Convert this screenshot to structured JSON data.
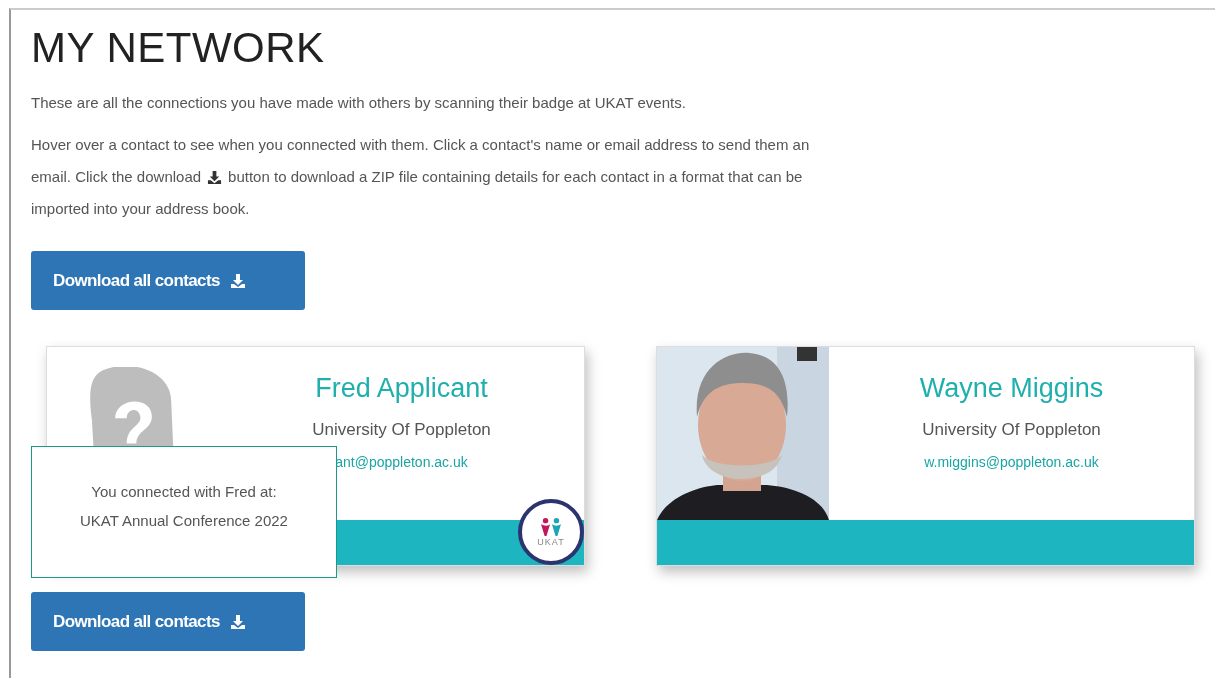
{
  "title": "MY NETWORK",
  "intro": "These are all the connections you have made with others by scanning their badge at UKAT events.",
  "instructions": {
    "line_1": "Hover over a contact to see when you connected with them. Click a contact's name or email address to send them an",
    "before_icon": "email. Click the download",
    "after_icon": "button to download a ZIP file containing details for each contact in a format that can be",
    "line_3": "imported into your address book."
  },
  "download_button_top": "Download all contacts",
  "contacts": [
    {
      "kind": "placeholder",
      "name": "Fred Applicant",
      "organisation": "University Of Poppleton",
      "email": "ant@poppleton.ac.uk",
      "badge": "UKAT"
    },
    {
      "kind": "picture",
      "name": "Wayne Miggins",
      "organisation": "University Of Poppleton",
      "email": "w.miggins@poppleton.ac.uk"
    }
  ],
  "tooltip": {
    "lines": [
      "You connected with Fred at:",
      "UKAT Annual Conference 2022"
    ]
  },
  "download_button_bottom": "Download all contacts"
}
